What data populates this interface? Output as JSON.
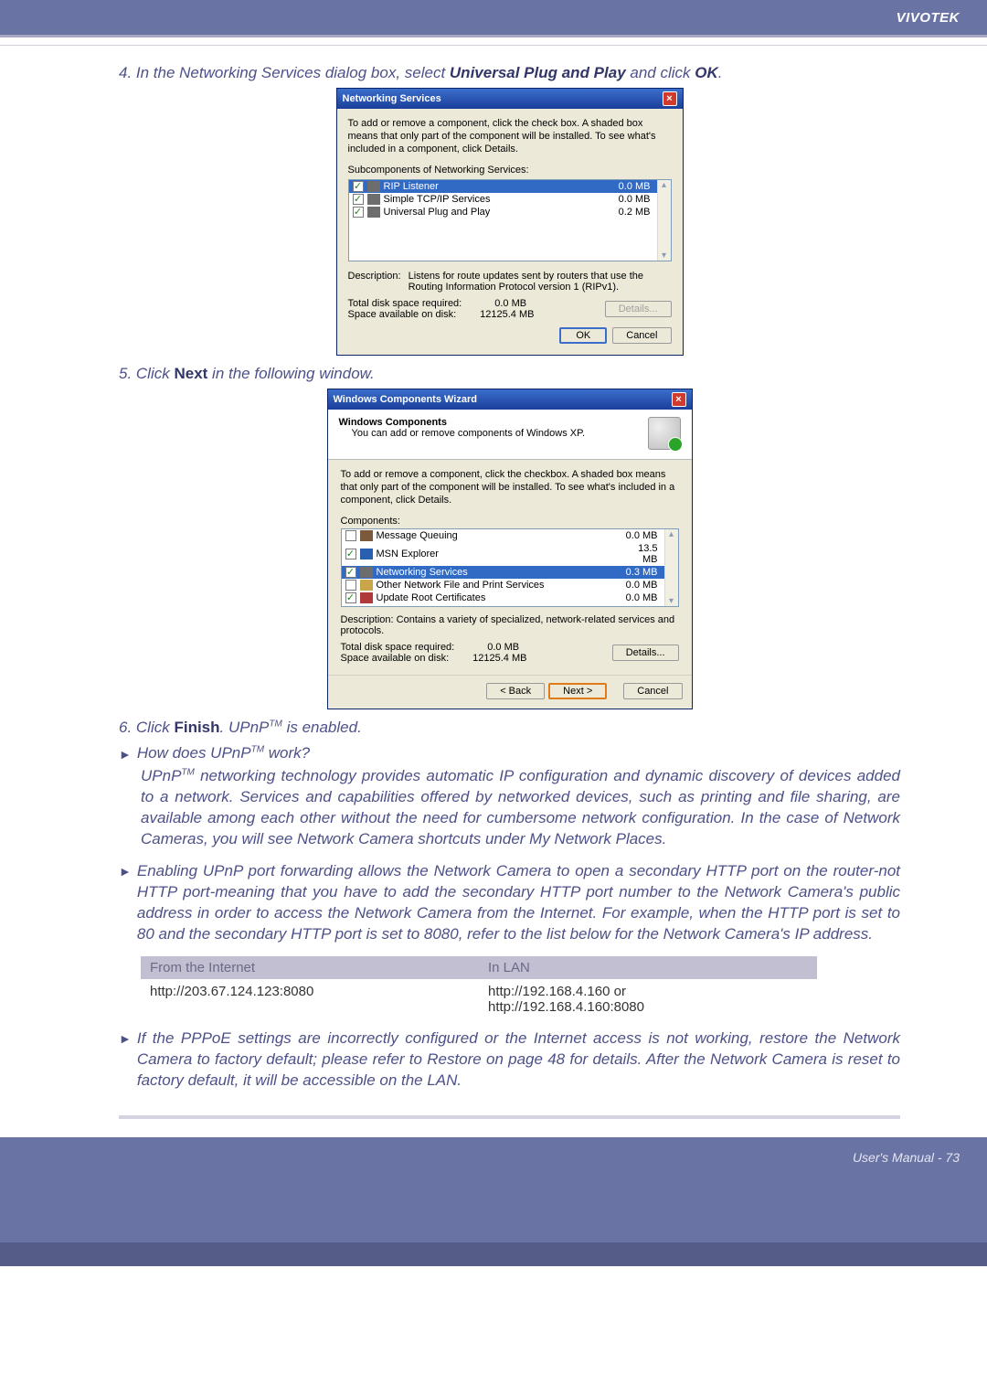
{
  "brand": "VIVOTEK",
  "step4_pre": "4. In the Networking Services dialog box, select ",
  "step4_bold": "Universal Plug and Play",
  "step4_mid": " and click ",
  "step4_ok": "OK",
  "step4_post": ".",
  "dlg1": {
    "title": "Networking Services",
    "intro": "To add or remove a component, click the check box. A shaded box means that only part of the component will be installed. To see what's included in a component, click Details.",
    "subhdr": "Subcomponents of Networking Services:",
    "rows": [
      {
        "label": "RIP Listener",
        "size": "0.0 MB",
        "selected": true
      },
      {
        "label": "Simple TCP/IP Services",
        "size": "0.0 MB",
        "selected": false
      },
      {
        "label": "Universal Plug and Play",
        "size": "0.2 MB",
        "selected": false
      }
    ],
    "desc_lbl": "Description:",
    "desc_txt": "Listens for route updates sent by routers that use the Routing Information Protocol version 1 (RIPv1).",
    "req_lbl": "Total disk space required:",
    "req_val": "0.0 MB",
    "avail_lbl": "Space available on disk:",
    "avail_val": "12125.4 MB",
    "details": "Details...",
    "ok": "OK",
    "cancel": "Cancel"
  },
  "step5_pre": "5. Click ",
  "step5_bold": "Next",
  "step5_post": " in the following window.",
  "dlg2": {
    "title": "Windows Components Wizard",
    "head_title": "Windows Components",
    "head_sub": "You can add or remove components of Windows XP.",
    "intro": "To add or remove a component, click the checkbox. A shaded box means that only part of the component will be installed. To see what's included in a component, click Details.",
    "comp_lbl": "Components:",
    "rows": [
      {
        "cb": false,
        "label": "Message Queuing",
        "size": "0.0 MB"
      },
      {
        "cb": true,
        "label": "MSN Explorer",
        "size": "13.5 MB"
      },
      {
        "cb": true,
        "label": "Networking Services",
        "size": "0.3 MB",
        "selected": true
      },
      {
        "cb": false,
        "label": "Other Network File and Print Services",
        "size": "0.0 MB"
      },
      {
        "cb": true,
        "label": "Update Root Certificates",
        "size": "0.0 MB"
      }
    ],
    "desc_full": "Description: Contains a variety of specialized, network-related services and protocols.",
    "req_lbl": "Total disk space required:",
    "req_val": "0.0 MB",
    "avail_lbl": "Space available on disk:",
    "avail_val": "12125.4 MB",
    "details": "Details...",
    "back": "< Back",
    "next": "Next >",
    "cancel": "Cancel"
  },
  "step6_pre": "6. Click ",
  "step6_bold": "Finish",
  "step6_mid": ". UPnP",
  "step6_post": " is enabled.",
  "tm": "TM",
  "q1_pre": "How does UPnP",
  "q1_post": " work?",
  "para1a": "UPnP",
  "para1b": " networking technology provides automatic IP configuration and dynamic discovery of devices added to a network. Services and capabilities offered by networked devices, such as printing and file sharing, are available among each other without the need for cumbersome network configuration. In the case of Network Cameras, you will see Network Camera shortcuts under My Network Places.",
  "para2": "Enabling UPnP port forwarding allows the Network Camera to open a secondary HTTP port on the router-not HTTP port-meaning that you have to add the secondary HTTP port number to the Network Camera's public address in order to access the Network Camera from the Internet. For example, when the HTTP port is set to 80 and the secondary HTTP port is set to 8080, refer to the list below for the Network Camera's IP address.",
  "tbl": {
    "h1": "From the Internet",
    "h2": "In LAN",
    "c1": "http://203.67.124.123:8080",
    "c2a": "http://192.168.4.160 or",
    "c2b": "http://192.168.4.160:8080"
  },
  "para3": "If the PPPoE settings are incorrectly configured or the Internet access is not working, restore the Network Camera to factory default; please refer to Restore on page 48 for details. After the Network Camera is reset to factory default, it will be accessible on the LAN.",
  "footer": "User's Manual - 73"
}
